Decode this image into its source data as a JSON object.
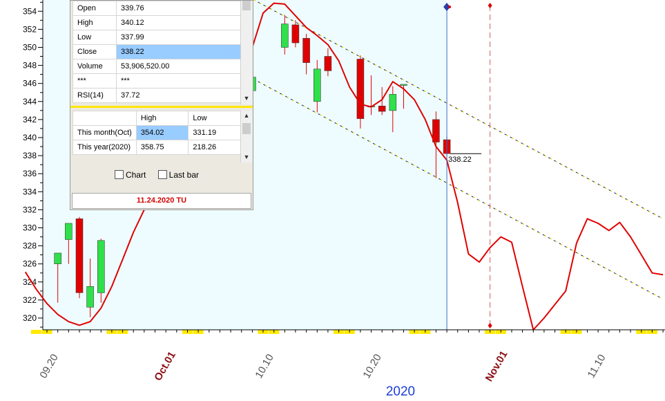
{
  "chart_data": {
    "type": "candlestick",
    "y_ticks": [
      "354",
      "352",
      "350",
      "348",
      "346",
      "344",
      "342",
      "340",
      "338",
      "336",
      "334",
      "332",
      "330",
      "328",
      "326",
      "324",
      "322",
      "320"
    ],
    "ylim": [
      318.7,
      355.4
    ],
    "x_labels": [
      {
        "text": "09.20",
        "color": "#555555",
        "bold": false
      },
      {
        "text": "Oct.01",
        "color": "#8b0f14",
        "bold": true
      },
      {
        "text": "10.10",
        "color": "#555555",
        "bold": false
      },
      {
        "text": "10.20",
        "color": "#555555",
        "bold": false
      },
      {
        "text": "Nov.01",
        "color": "#8b0f14",
        "bold": true
      },
      {
        "text": "11.10",
        "color": "#555555",
        "bold": false
      }
    ],
    "year_label": "2020",
    "last_close_label": "338.22",
    "candles": [
      {
        "date": "2020-09-21",
        "open": 326.0,
        "high": 327.2,
        "low": 321.7,
        "close": 327.2
      },
      {
        "date": "2020-09-22",
        "open": 328.7,
        "high": 330.5,
        "low": 326.0,
        "close": 330.5
      },
      {
        "date": "2020-09-23",
        "open": 331.0,
        "high": 331.2,
        "low": 322.2,
        "close": 322.8
      },
      {
        "date": "2020-09-24",
        "open": 321.2,
        "high": 326.6,
        "low": 320.1,
        "close": 323.5
      },
      {
        "date": "2020-09-25",
        "open": 322.8,
        "high": 328.8,
        "low": 321.7,
        "close": 328.6
      },
      {
        "date": "2020-10-09",
        "open": 345.2,
        "high": 347.5,
        "low": 344.8,
        "close": 346.7
      },
      {
        "date": "2020-10-12",
        "open": 350.0,
        "high": 353.6,
        "low": 349.2,
        "close": 352.6
      },
      {
        "date": "2020-10-13",
        "open": 352.5,
        "high": 353.0,
        "low": 350.0,
        "close": 350.5
      },
      {
        "date": "2020-10-14",
        "open": 351.0,
        "high": 351.5,
        "low": 347.0,
        "close": 348.3
      },
      {
        "date": "2020-10-15",
        "open": 344.0,
        "high": 348.6,
        "low": 342.8,
        "close": 347.6
      },
      {
        "date": "2020-10-16",
        "open": 349.0,
        "high": 349.9,
        "low": 346.8,
        "close": 347.4
      },
      {
        "date": "2020-10-19",
        "open": 348.7,
        "high": 349.1,
        "low": 341.0,
        "close": 342.1
      },
      {
        "date": "2020-10-20",
        "open": 343.5,
        "high": 346.9,
        "low": 342.5,
        "close": 343.5
      },
      {
        "date": "2020-10-21",
        "open": 343.5,
        "high": 345.6,
        "low": 342.5,
        "close": 342.9
      },
      {
        "date": "2020-10-22",
        "open": 343.0,
        "high": 345.7,
        "low": 340.6,
        "close": 344.8
      },
      {
        "date": "2020-10-23",
        "open": 345.9,
        "high": 345.9,
        "low": 343.2,
        "close": 345.9
      },
      {
        "date": "2020-10-26",
        "open": 342.0,
        "high": 342.9,
        "low": 335.5,
        "close": 339.5
      },
      {
        "date": "2020-10-27",
        "open": 339.76,
        "high": 340.12,
        "low": 337.99,
        "close": 338.22
      }
    ],
    "series": [
      {
        "color": "#e00000",
        "points": [
          {
            "x": "2020-09-18",
            "y": 325.1
          },
          {
            "x": "2020-09-19",
            "y": 323.2
          },
          {
            "x": "2020-09-20",
            "y": 321.6
          },
          {
            "x": "2020-09-21",
            "y": 320.4
          },
          {
            "x": "2020-09-22",
            "y": 319.6
          },
          {
            "x": "2020-09-23",
            "y": 319.2
          },
          {
            "x": "2020-09-24",
            "y": 319.6
          },
          {
            "x": "2020-09-25",
            "y": 321.1
          },
          {
            "x": "2020-09-26",
            "y": 323.5
          },
          {
            "x": "2020-09-27",
            "y": 326.5
          },
          {
            "x": "2020-09-28",
            "y": 329.5
          },
          {
            "x": "2020-09-29",
            "y": 332.0
          },
          {
            "x": "2020-10-08",
            "y": 346.0
          },
          {
            "x": "2020-10-09",
            "y": 350.0
          },
          {
            "x": "2020-10-10",
            "y": 353.8
          },
          {
            "x": "2020-10-11",
            "y": 354.9
          },
          {
            "x": "2020-10-12",
            "y": 354.8
          },
          {
            "x": "2020-10-13",
            "y": 353.5
          },
          {
            "x": "2020-10-14",
            "y": 352.2
          },
          {
            "x": "2020-10-15",
            "y": 351.3
          },
          {
            "x": "2020-10-16",
            "y": 350.3
          },
          {
            "x": "2020-10-17",
            "y": 348.5
          },
          {
            "x": "2020-10-18",
            "y": 345.6
          },
          {
            "x": "2020-10-19",
            "y": 343.7
          },
          {
            "x": "2020-10-20",
            "y": 343.4
          },
          {
            "x": "2020-10-21",
            "y": 344.2
          },
          {
            "x": "2020-10-22",
            "y": 346.2
          },
          {
            "x": "2020-10-23",
            "y": 345.4
          },
          {
            "x": "2020-10-24",
            "y": 344.2
          },
          {
            "x": "2020-10-25",
            "y": 342.0
          },
          {
            "x": "2020-10-26",
            "y": 339.0
          },
          {
            "x": "2020-10-27",
            "y": 337.5
          },
          {
            "x": "2020-10-28",
            "y": 332.8
          },
          {
            "x": "2020-10-29",
            "y": 327.1
          },
          {
            "x": "2020-10-30",
            "y": 326.2
          },
          {
            "x": "2020-10-31",
            "y": 327.8
          },
          {
            "x": "2020-11-01",
            "y": 329.0
          },
          {
            "x": "2020-11-02",
            "y": 328.4
          },
          {
            "x": "2020-11-03",
            "y": 323.5
          },
          {
            "x": "2020-11-04",
            "y": 318.7
          },
          {
            "x": "2020-11-05",
            "y": 320.0
          },
          {
            "x": "2020-11-06",
            "y": 321.5
          },
          {
            "x": "2020-11-07",
            "y": 323.0
          },
          {
            "x": "2020-11-08",
            "y": 328.3
          },
          {
            "x": "2020-11-09",
            "y": 331.0
          },
          {
            "x": "2020-11-10",
            "y": 330.5
          },
          {
            "x": "2020-11-11",
            "y": 329.7
          },
          {
            "x": "2020-11-12",
            "y": 330.6
          },
          {
            "x": "2020-11-13",
            "y": 329.0
          },
          {
            "x": "2020-11-14",
            "y": 327.0
          },
          {
            "x": "2020-11-15",
            "y": 325.0
          },
          {
            "x": "2020-11-16",
            "y": 324.8
          }
        ]
      }
    ],
    "trend_channel": {
      "upper": [
        {
          "x": "2020-10-08",
          "y": 356.0
        },
        {
          "x": "2020-11-16",
          "y": 331.0
        }
      ],
      "lower": [
        {
          "x": "2020-10-08",
          "y": 347.2
        },
        {
          "x": "2020-11-16",
          "y": 322.1
        }
      ]
    },
    "markers": {
      "cursor_date": "2020-10-27",
      "dashed_date": "2020-10-31"
    },
    "weekend_dates": [
      "2020-09-19",
      "2020-09-20",
      "2020-09-26",
      "2020-09-27",
      "2020-10-03",
      "2020-10-04",
      "2020-10-10",
      "2020-10-11",
      "2020-10-17",
      "2020-10-18",
      "2020-10-24",
      "2020-10-25",
      "2020-10-31",
      "2020-11-01",
      "2020-11-07",
      "2020-11-08",
      "2020-11-14",
      "2020-11-15"
    ]
  },
  "info_panel": {
    "quote": [
      {
        "label": "Open",
        "value": "339.76"
      },
      {
        "label": "High",
        "value": "340.12"
      },
      {
        "label": "Low",
        "value": "337.99"
      },
      {
        "label": "Close",
        "value": "338.22"
      },
      {
        "label": "Volume",
        "value": "53,906,520.00"
      },
      {
        "label": "***",
        "value": "***"
      },
      {
        "label": "RSI(14)",
        "value": "37.72"
      }
    ],
    "range_headers": {
      "high": "High",
      "low": "Low"
    },
    "range_rows": [
      {
        "label": "This month(Oct)",
        "high": "354.02",
        "low": "331.19"
      },
      {
        "label": "This year(2020)",
        "high": "358.75",
        "low": "218.26"
      }
    ],
    "chart_checkbox": "Chart",
    "lastbar_checkbox": "Last bar",
    "date": "11.24.2020 TU"
  }
}
